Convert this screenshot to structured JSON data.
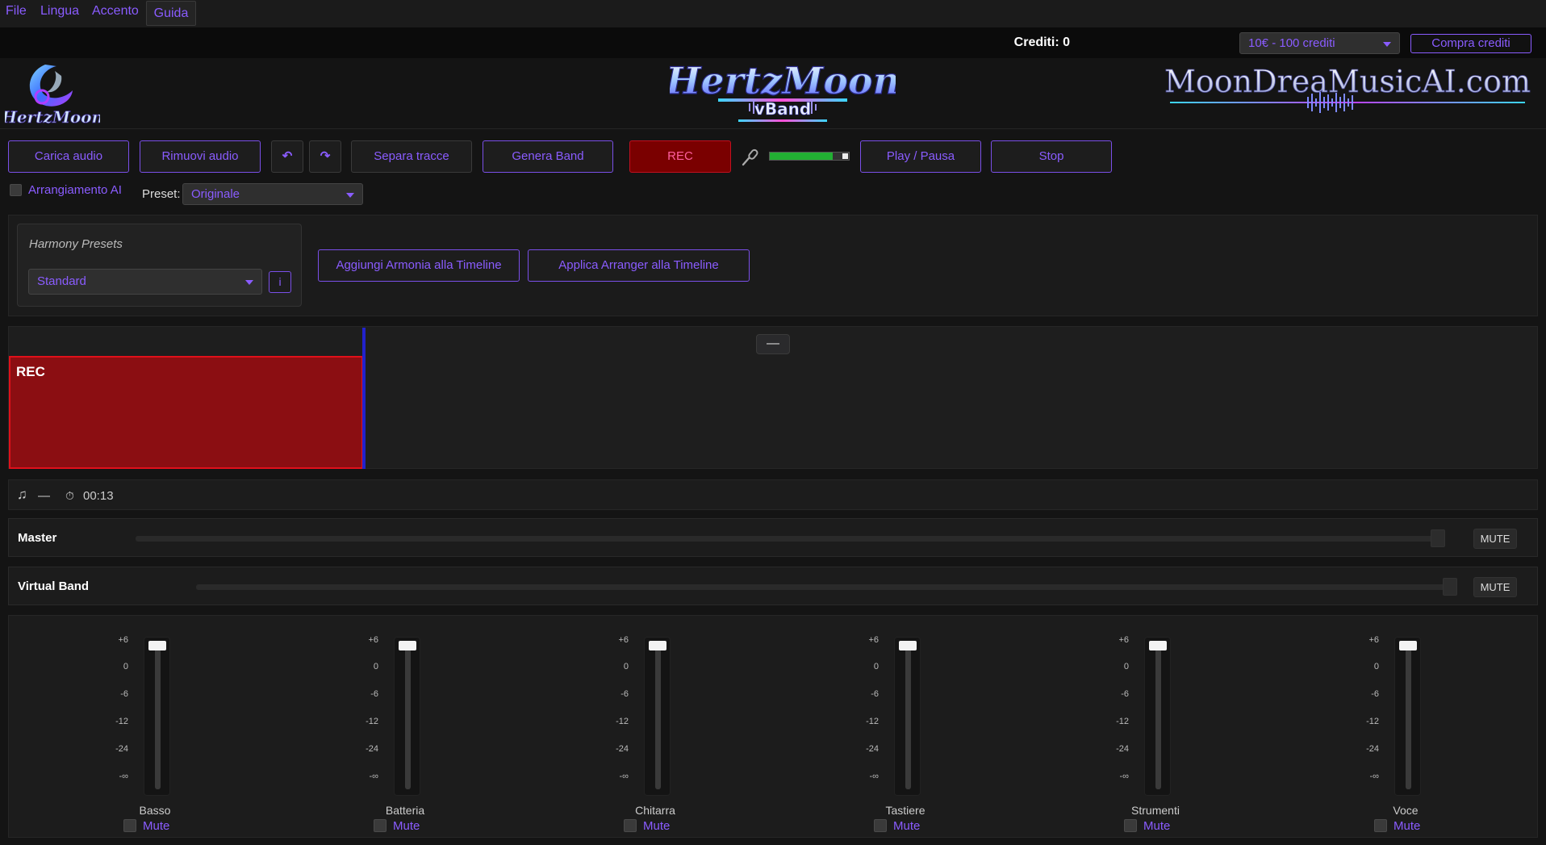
{
  "menu": {
    "items": [
      "File",
      "Lingua",
      "Accento"
    ],
    "active": "Guida"
  },
  "credits": {
    "label": "Crediti: 0",
    "package_selected": "10€ - 100 crediti",
    "buy_label": "Compra crediti"
  },
  "logos": {
    "left": "HertzMoon",
    "center_main": "HertzMoon",
    "center_sub": "vBand",
    "right": "MoonDreaMusicAI.com"
  },
  "toolbar": {
    "load_audio": "Carica audio",
    "remove_audio": "Rimuovi audio",
    "undo_icon": "↶",
    "redo_icon": "↷",
    "separate_tracks": "Separa tracce",
    "generate_band": "Genera Band",
    "rec": "REC",
    "mic_level": 0.8,
    "play_pause": "Play / Pausa",
    "stop": "Stop"
  },
  "options": {
    "ai_arrangement": "Arrangiamento AI",
    "preset_label": "Preset:",
    "preset_value": "Originale"
  },
  "harmony": {
    "title": "Harmony Presets",
    "selected": "Standard",
    "info": "i",
    "add_button": "Aggiungi Armonia alla Timeline",
    "apply_button": "Applica Arranger alla Timeline"
  },
  "timeline": {
    "collapse_label": "—",
    "clip_label": "REC"
  },
  "status": {
    "note_icon": "♫",
    "dash": "—",
    "timer_icon": "⏱",
    "time": "00:13"
  },
  "master": {
    "name": "Master",
    "mute": "MUTE"
  },
  "virtual_band": {
    "name": "Virtual Band",
    "mute": "MUTE"
  },
  "mixer": {
    "scale": [
      "+6",
      "0",
      "-6",
      "-12",
      "-24",
      "-∞"
    ],
    "mute_label": "Mute",
    "channels": [
      "Basso",
      "Batteria",
      "Chitarra",
      "Tastiere",
      "Strumenti",
      "Voce"
    ]
  },
  "colors": {
    "accent": "#8a5cff",
    "rec_red": "#8b0e12",
    "meter_green": "#22b033"
  }
}
